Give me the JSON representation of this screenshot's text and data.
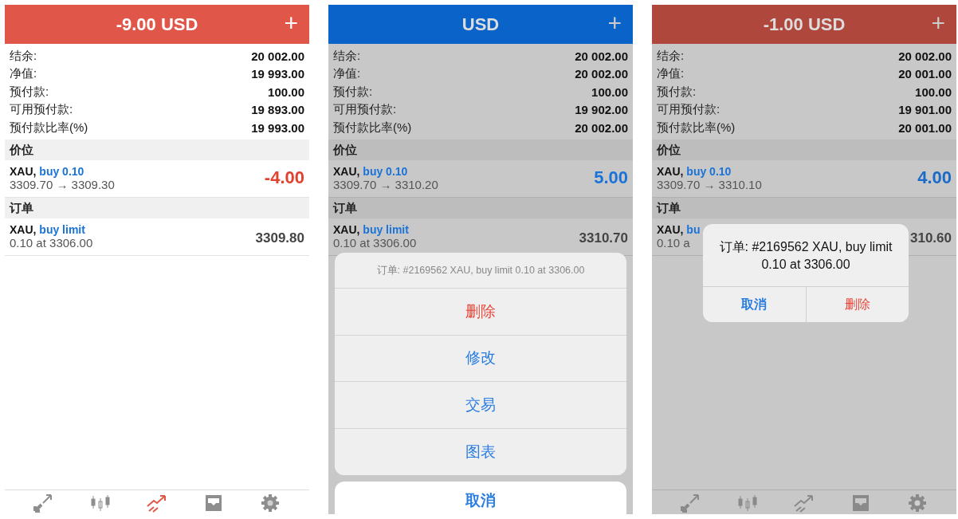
{
  "panels": [
    {
      "dimmed": false,
      "header": {
        "title": "-9.00 USD",
        "color": "#e0574a",
        "add": "+"
      },
      "summary": [
        {
          "label": "结余:",
          "value": "20 002.00"
        },
        {
          "label": "净值:",
          "value": "19 993.00"
        },
        {
          "label": "预付款:",
          "value": "100.00"
        },
        {
          "label": "可用预付款:",
          "value": "19 893.00"
        },
        {
          "label": "预付款比率(%)",
          "value": "19 993.00"
        }
      ],
      "positions_heading": "价位",
      "positions": [
        {
          "symbol": "XAU,",
          "side": "buy 0.10",
          "prices": "3309.70 → 3309.30",
          "profit": "-4.00",
          "color": "#e2412f"
        }
      ],
      "orders_heading": "订单",
      "orders": [
        {
          "symbol": "XAU,",
          "side": "buy limit",
          "detail": "0.10 at 3306.00",
          "price": "3309.80"
        }
      ],
      "tabs": [
        {
          "kind": "quotes",
          "selected": false
        },
        {
          "kind": "chart",
          "selected": false
        },
        {
          "kind": "trade",
          "selected": true
        },
        {
          "kind": "history",
          "selected": false
        },
        {
          "kind": "settings",
          "selected": false
        }
      ]
    },
    {
      "dimmed": true,
      "header": {
        "title": "USD",
        "color": "#0a63c9",
        "add": "+"
      },
      "summary": [
        {
          "label": "结余:",
          "value": "20 002.00"
        },
        {
          "label": "净值:",
          "value": "20 002.00"
        },
        {
          "label": "预付款:",
          "value": "100.00"
        },
        {
          "label": "可用预付款:",
          "value": "19 902.00"
        },
        {
          "label": "预付款比率(%)",
          "value": "20 002.00"
        }
      ],
      "positions_heading": "价位",
      "positions": [
        {
          "symbol": "XAU,",
          "side": "buy 0.10",
          "prices": "3309.70 → 3310.20",
          "profit": "5.00",
          "color": "#1a73d9"
        }
      ],
      "orders_heading": "订单",
      "orders": [
        {
          "symbol": "XAU,",
          "side": "buy limit",
          "detail": "0.10 at 3306.00",
          "price": "3310.70"
        }
      ],
      "overlay": {
        "kind": "action_sheet",
        "title": "订单: #2169562 XAU, buy limit 0.10 at 3306.00",
        "actions": [
          {
            "label": "删除",
            "kind": "destructive"
          },
          {
            "label": "修改",
            "kind": "default"
          },
          {
            "label": "交易",
            "kind": "default"
          },
          {
            "label": "图表",
            "kind": "default"
          }
        ],
        "cancel": "取消"
      }
    },
    {
      "dimmed": true,
      "header": {
        "title": "-1.00 USD",
        "color": "#b0473c",
        "add": "+"
      },
      "summary": [
        {
          "label": "结余:",
          "value": "20 002.00"
        },
        {
          "label": "净值:",
          "value": "20 001.00"
        },
        {
          "label": "预付款:",
          "value": "100.00"
        },
        {
          "label": "可用预付款:",
          "value": "19 901.00"
        },
        {
          "label": "预付款比率(%)",
          "value": "20 001.00"
        }
      ],
      "positions_heading": "价位",
      "positions": [
        {
          "symbol": "XAU,",
          "side": "buy 0.10",
          "prices": "3309.70 → 3310.10",
          "profit": "4.00",
          "color": "#1a6ac8"
        }
      ],
      "orders_heading": "订单",
      "orders": [
        {
          "symbol": "XAU,",
          "side": "bu",
          "detail": "0.10 a",
          "price": "310.60"
        }
      ],
      "tabs": [
        {
          "kind": "quotes",
          "selected": false
        },
        {
          "kind": "chart",
          "selected": false
        },
        {
          "kind": "trade",
          "selected": false
        },
        {
          "kind": "history",
          "selected": false
        },
        {
          "kind": "settings",
          "selected": false
        }
      ],
      "overlay": {
        "kind": "alert",
        "title": "订单: #2169562 XAU, buy limit 0.10 at 3306.00",
        "actions": [
          {
            "label": "取消",
            "kind": "cancel"
          },
          {
            "label": "删除",
            "kind": "destructive"
          }
        ]
      }
    }
  ]
}
